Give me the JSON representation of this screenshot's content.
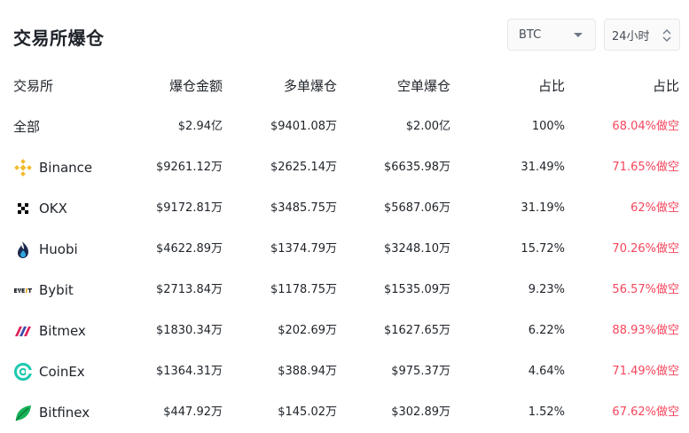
{
  "header": {
    "title": "交易所爆仓",
    "coin_select": "BTC",
    "period_select": "24小时"
  },
  "table": {
    "columns": [
      "交易所",
      "爆仓金额",
      "多单爆仓",
      "空单爆仓",
      "占比",
      "占比"
    ],
    "rows": [
      {
        "exchange": "全部",
        "icon": "",
        "total": "$2.94亿",
        "long": "$9401.08万",
        "short": "$2.00亿",
        "share": "100%",
        "ratio": "68.04%做空"
      },
      {
        "exchange": "Binance",
        "icon": "binance-logo-icon",
        "total": "$9261.12万",
        "long": "$2625.14万",
        "short": "$6635.98万",
        "share": "31.49%",
        "ratio": "71.65%做空"
      },
      {
        "exchange": "OKX",
        "icon": "okx-logo-icon",
        "total": "$9172.81万",
        "long": "$3485.75万",
        "short": "$5687.06万",
        "share": "31.19%",
        "ratio": "62%做空"
      },
      {
        "exchange": "Huobi",
        "icon": "huobi-logo-icon",
        "total": "$4622.89万",
        "long": "$1374.79万",
        "short": "$3248.10万",
        "share": "15.72%",
        "ratio": "70.26%做空"
      },
      {
        "exchange": "Bybit",
        "icon": "bybit-logo-icon",
        "total": "$2713.84万",
        "long": "$1178.75万",
        "short": "$1535.09万",
        "share": "9.23%",
        "ratio": "56.57%做空"
      },
      {
        "exchange": "Bitmex",
        "icon": "bitmex-logo-icon",
        "total": "$1830.34万",
        "long": "$202.69万",
        "short": "$1627.65万",
        "share": "6.22%",
        "ratio": "88.93%做空"
      },
      {
        "exchange": "CoinEx",
        "icon": "coinex-logo-icon",
        "total": "$1364.31万",
        "long": "$388.94万",
        "short": "$975.37万",
        "share": "4.64%",
        "ratio": "71.49%做空"
      },
      {
        "exchange": "Bitfinex",
        "icon": "bitfinex-logo-icon",
        "total": "$447.92万",
        "long": "$145.02万",
        "short": "$302.89万",
        "share": "1.52%",
        "ratio": "67.62%做空"
      }
    ]
  },
  "colors": {
    "short_ratio": "#f6465d",
    "binance": "#f3ba2f",
    "coinex": "#1ec8b0",
    "bitfinex": "#16b157"
  }
}
